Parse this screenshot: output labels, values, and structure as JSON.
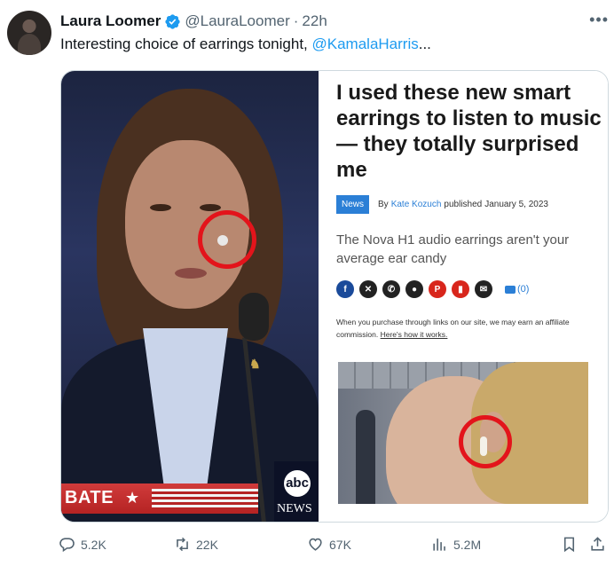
{
  "tweet": {
    "author_name": "Laura Loomer",
    "handle": "@LauraLoomer",
    "separator": "·",
    "time": "22h",
    "text": "Interesting choice of earrings tonight, ",
    "mention": "@KamalaHarris",
    "ellipsis": "..."
  },
  "media": {
    "left_image": {
      "lower_third_text": "BATE",
      "network_label": "NEWS",
      "network_logo": "abc"
    },
    "article": {
      "headline": "I used these new smart earrings to listen to music — they totally surprised me",
      "tag": "News",
      "by_label": "By",
      "author": "Kate Kozuch",
      "published_label": "published",
      "date": "January 5, 2023",
      "subhead": "The Nova H1 audio earrings aren't your average ear candy",
      "comments": "(0)",
      "disclaimer": "When you purchase through links on our site, we may earn an affiliate commission.",
      "disclaimer_link": "Here's how it works."
    }
  },
  "actions": {
    "replies": "5.2K",
    "reposts": "22K",
    "likes": "67K",
    "views": "5.2M"
  }
}
